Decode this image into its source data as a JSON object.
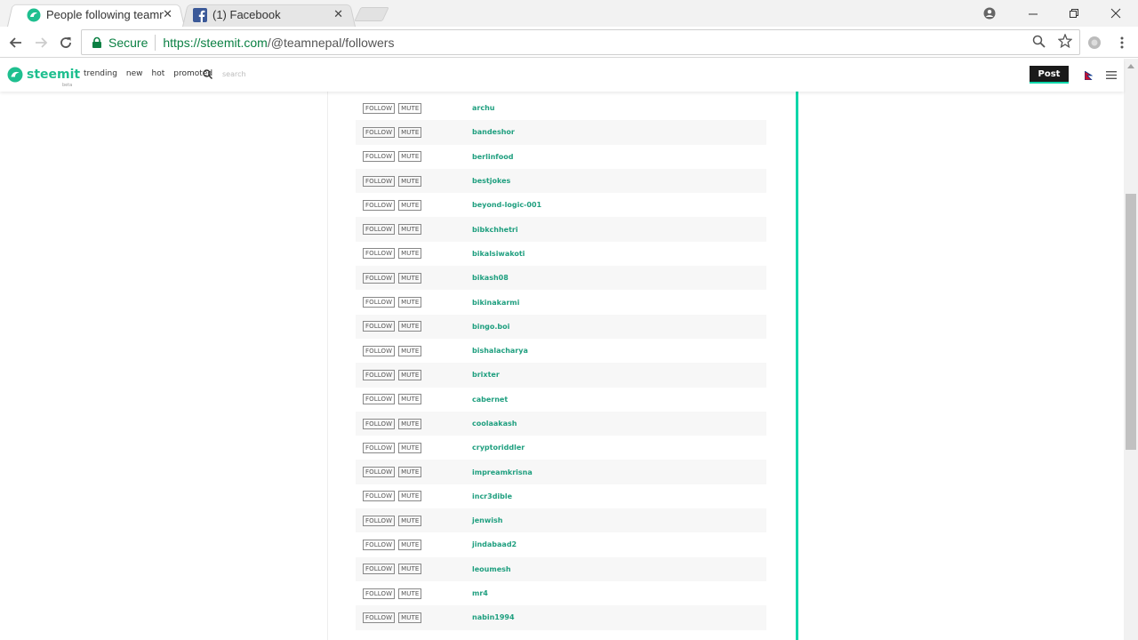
{
  "browser": {
    "tabs": [
      {
        "title": "People following teamne",
        "active": true
      },
      {
        "title": "(1) Facebook",
        "active": false
      }
    ],
    "secure_label": "Secure",
    "url_scheme_host": "https://steemit.com",
    "url_path": "/@teamnepal/followers"
  },
  "site": {
    "logo_text": "steemit",
    "logo_beta": "beta",
    "nav": [
      "trending",
      "new",
      "hot",
      "promoted"
    ],
    "search_placeholder": "search",
    "post_label": "Post"
  },
  "list": {
    "follow_label": "FOLLOW",
    "mute_label": "MUTE",
    "users": [
      "archu",
      "bandeshor",
      "berlinfood",
      "bestjokes",
      "beyond-logic-001",
      "bibkchhetri",
      "bikalsiwakoti",
      "bikash08",
      "bikinakarmi",
      "bingo.boi",
      "bishalacharya",
      "brixter",
      "cabernet",
      "coolaakash",
      "cryptoriddler",
      "impreamkrisna",
      "incr3dible",
      "jenwish",
      "jindabaad2",
      "leoumesh",
      "mr4",
      "nabin1994"
    ]
  },
  "colors": {
    "accent": "#06d6a9",
    "username": "#1f9f7f",
    "secure": "#0b8043"
  }
}
